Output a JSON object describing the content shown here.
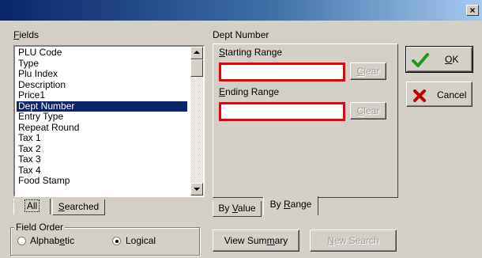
{
  "window": {
    "close_glyph": "×"
  },
  "fields": {
    "label": "Fields",
    "items": [
      "PLU Code",
      "Type",
      "Plu Index",
      "Description",
      "Price1",
      "Dept Number",
      "Entry Type",
      "Repeat Round",
      "Tax 1",
      "Tax 2",
      "Tax 3",
      "Tax 4",
      "Food Stamp"
    ],
    "selected_index": 5
  },
  "list_tabs": {
    "all": "All",
    "searched": "Searched"
  },
  "field_order": {
    "caption": "Field Order",
    "alphabetic": "Alphabetic",
    "logical": "Logical",
    "selected": "logical"
  },
  "criteria": {
    "title": "Dept Number",
    "starting_label": "Starting Range",
    "starting_value": "",
    "ending_label": "Ending Range",
    "ending_value": "",
    "clear_label": "Clear"
  },
  "criteria_tabs": {
    "by_value": "By Value",
    "by_range": "By Range",
    "active": "by_range"
  },
  "actions": {
    "ok": "OK",
    "cancel": "Cancel",
    "view_summary": "View Summary",
    "new_search": "New Search"
  },
  "colors": {
    "title_start": "#0a246a",
    "title_end": "#a6caf0",
    "selection": "#0a246a",
    "highlight_border": "#e8000c",
    "ok_check": "#1a9a1a",
    "cancel_x": "#c00000"
  }
}
